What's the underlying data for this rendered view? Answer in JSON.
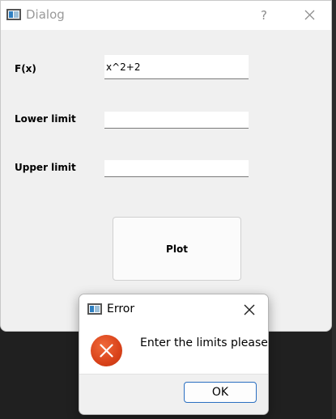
{
  "dialog": {
    "title": "Dialog",
    "help_label": "?",
    "close_icon": "close-icon",
    "fields": {
      "fx": {
        "label": "F(x)",
        "value": "x^2+2"
      },
      "lower": {
        "label": "Lower limit",
        "value": ""
      },
      "upper": {
        "label": "Upper limit",
        "value": ""
      }
    },
    "plot_label": "Plot"
  },
  "error": {
    "title": "Error",
    "message": "Enter the limits please",
    "ok_label": "OK",
    "icon": "error-icon",
    "accent": "#2a6fc1",
    "icon_color": "#d9421a"
  }
}
